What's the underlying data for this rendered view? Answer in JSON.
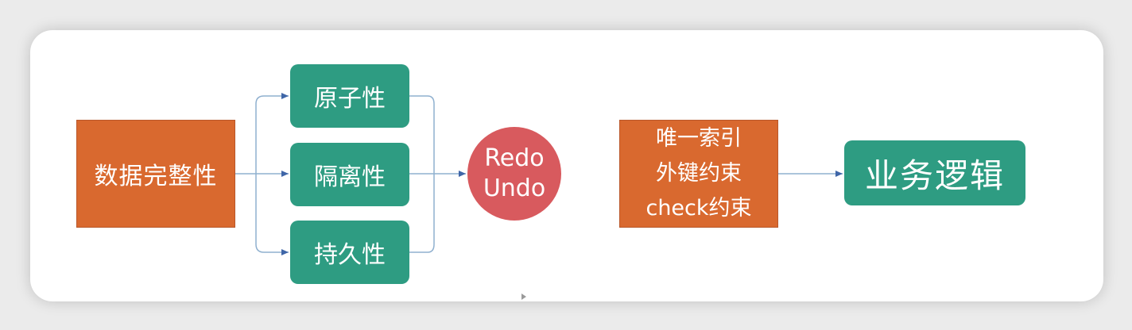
{
  "diagram": {
    "integrity": "数据完整性",
    "properties": [
      "原子性",
      "隔离性",
      "持久性"
    ],
    "mechanism": [
      "Redo",
      "Undo"
    ],
    "constraints": [
      "唯一索引",
      "外键约束",
      "check约束"
    ],
    "business_logic": "业务逻辑"
  },
  "colors": {
    "orange": "#d9692f",
    "green": "#2e9c82",
    "red_circle": "#d85a5e",
    "connector": "#6f8fb4"
  }
}
